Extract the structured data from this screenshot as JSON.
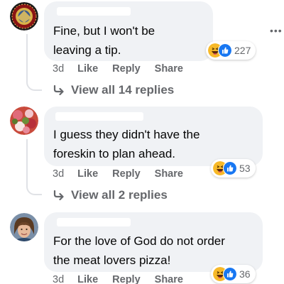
{
  "comments": [
    {
      "text_lines": [
        "Fine, but I won't be",
        "leaving a tip."
      ],
      "reaction_count": "227",
      "time": "3d",
      "like_label": "Like",
      "reply_label": "Reply",
      "share_label": "Share",
      "replies_label": "View all 14 replies",
      "avatar": "marine-corps-emblem"
    },
    {
      "text_lines": [
        "I guess they didn't have the",
        "foreskin to plan ahead."
      ],
      "reaction_count": "53",
      "time": "3d",
      "like_label": "Like",
      "reply_label": "Reply",
      "share_label": "Share",
      "replies_label": "View all 2 replies",
      "avatar": "flowers-photo"
    },
    {
      "text_lines": [
        "For the love of God do not order",
        "the meat lovers pizza!"
      ],
      "reaction_count": "36",
      "time": "3d",
      "like_label": "Like",
      "reply_label": "Reply",
      "share_label": "Share",
      "avatar": "person-photo"
    }
  ],
  "menu": {
    "more_label": "•••"
  },
  "colors": {
    "bubble": "#f0f2f5",
    "secondary_text": "#65676b",
    "like_blue": "#1877f2",
    "haha_yellow": "#f7b928"
  },
  "icons": [
    "haha-reaction-icon",
    "like-reaction-icon",
    "reply-arrow-icon",
    "more-options-icon"
  ]
}
